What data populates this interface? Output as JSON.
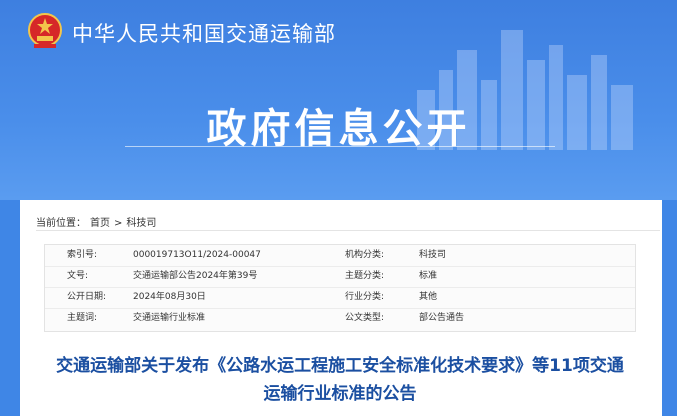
{
  "header": {
    "ministry_name": "中华人民共和国交通运输部",
    "page_title": "政府信息公开"
  },
  "breadcrumb": {
    "label": "当前位置：",
    "home": "首页",
    "separator": ">",
    "current": "科技司"
  },
  "info": {
    "rows": [
      {
        "k1": "索引号:",
        "v1": "000019713O11/2024-00047",
        "k2": "机构分类:",
        "v2": "科技司"
      },
      {
        "k1": "文号:",
        "v1": "交通运输部公告2024年第39号",
        "k2": "主题分类:",
        "v2": "标准"
      },
      {
        "k1": "公开日期:",
        "v1": "2024年08月30日",
        "k2": "行业分类:",
        "v2": "其他"
      },
      {
        "k1": "主题词:",
        "v1": "交通运输行业标准",
        "k2": "公文类型:",
        "v2": "部公告通告"
      }
    ]
  },
  "article": {
    "title_line1": "交通运输部关于发布《公路水运工程施工安全标准化技术要求》等11项交通",
    "title_line2": "运输行业标准的公告"
  },
  "colors": {
    "banner": "#3f86e6",
    "headline": "#1b4fa1"
  }
}
